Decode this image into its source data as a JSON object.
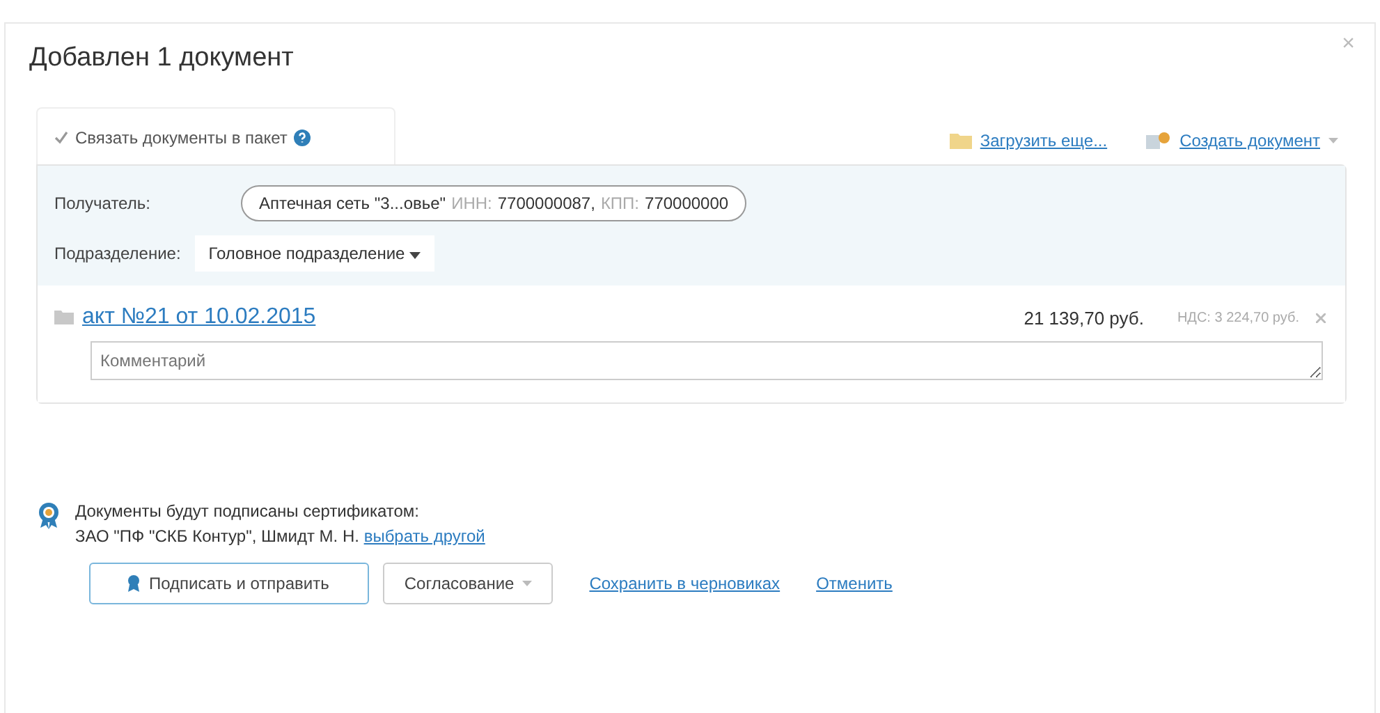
{
  "dialog": {
    "title": "Добавлен 1 документ",
    "close": "×"
  },
  "package_tab": {
    "label": "Связать документы в пакет",
    "checked": true
  },
  "actions": [
    {
      "kind": "upload",
      "label": "Загрузить еще..."
    },
    {
      "kind": "create",
      "label": "Создать документ"
    }
  ],
  "recipient": {
    "label": "Получатель:",
    "name": "Аптечная сеть \"3...овье\"",
    "inn_label": "ИНН:",
    "inn": "7700000087,",
    "kpp_label": "КПП:",
    "kpp": "770000000"
  },
  "division": {
    "label": "Подразделение:",
    "value": "Головное подразделение"
  },
  "document": {
    "title": "акт №21 от 10.02.2015",
    "sum": "21 139,70 руб.",
    "vat": "НДС: 3 224,70 руб.",
    "comment_placeholder": "Комментарий"
  },
  "certificate": {
    "line1": "Документы будут подписаны сертификатом:",
    "line2": "ЗАО \"ПФ \"СКБ Контур\", Шмидт М. Н.",
    "change_link": "выбрать другой"
  },
  "buttons": [
    {
      "kind": "primary",
      "label": "Подписать и отправить"
    },
    {
      "kind": "dropdown",
      "label": "Согласование"
    },
    {
      "kind": "link",
      "label": "Сохранить в черновиках"
    },
    {
      "kind": "link",
      "label": "Отменить"
    }
  ]
}
